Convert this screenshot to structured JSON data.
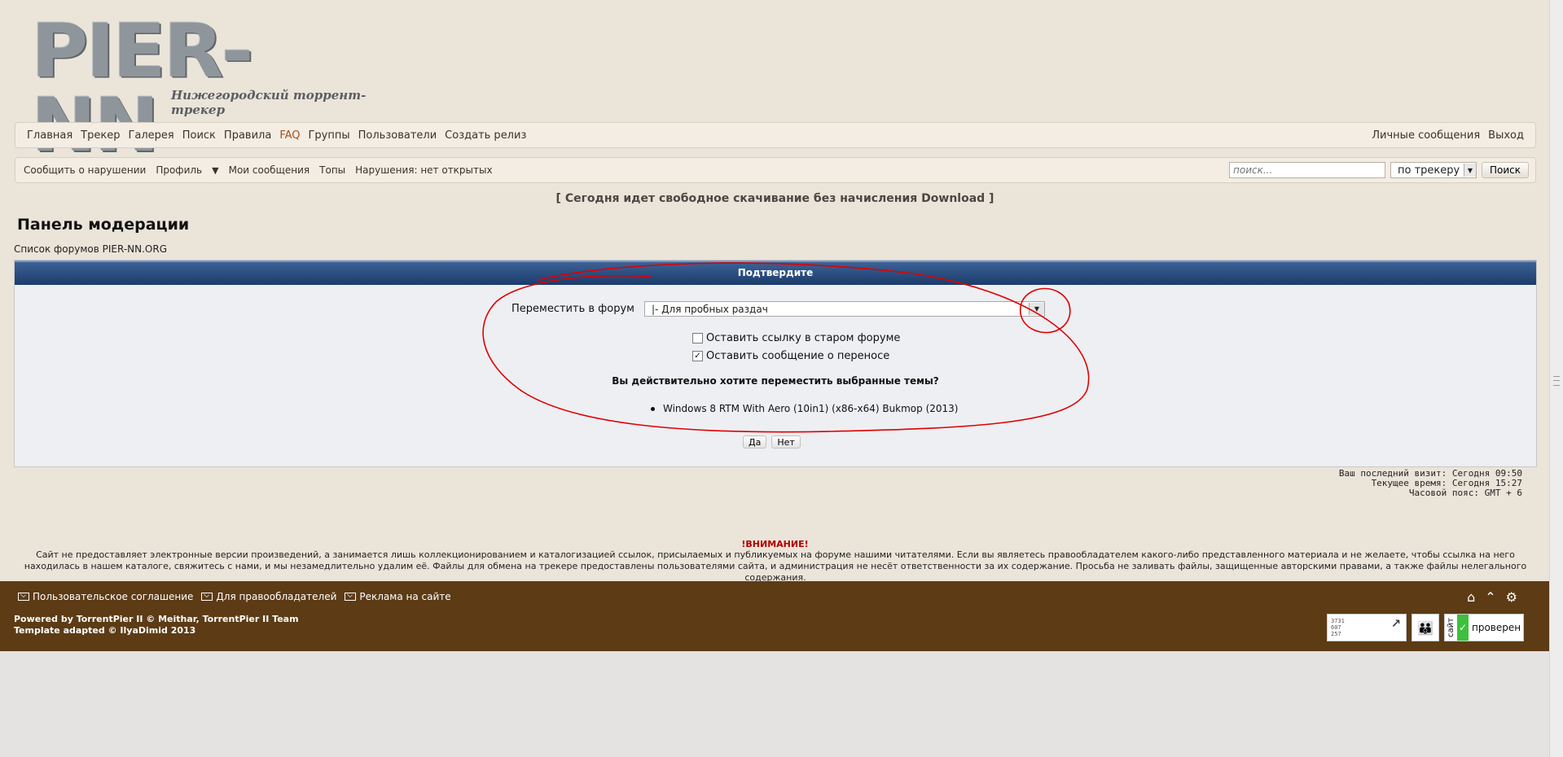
{
  "logo": {
    "title": "PIER-NN",
    "subtitle": "Нижегородский торрент-трекер"
  },
  "nav": {
    "items": [
      "Главная",
      "Трекер",
      "Галерея",
      "Поиск",
      "Правила",
      "FAQ",
      "Группы",
      "Пользователи",
      "Создать релиз"
    ],
    "right": [
      "Личные сообщения",
      "Выход"
    ]
  },
  "subnav": {
    "items": [
      "Сообщить о нарушении",
      "Профиль",
      "Мои сообщения",
      "Топы",
      "Нарушения: нет открытых"
    ],
    "search_placeholder": "поиск...",
    "search_scope": "по трекеру",
    "search_button": "Поиск"
  },
  "announcement": "[ Сегодня идет свободное скачивание без начисления Download ]",
  "page_title": "Панель модерации",
  "breadcrumb": "Список форумов PIER-NN.ORG",
  "panel": {
    "header": "Подтвердите",
    "move_label": "Переместить в форум",
    "forum_value": "|- Для пробных раздач",
    "leave_link": "Оставить ссылку в старом форуме",
    "leave_link_checked": false,
    "leave_message": "Оставить сообщение о переносе",
    "leave_message_checked": true,
    "question": "Вы действительно хотите переместить выбранные темы?",
    "topic": "Windows 8 RTM With Aero (10in1) (x86-x64) Bukmop (2013)",
    "yes": "Да",
    "no": "Нет"
  },
  "visit": {
    "last": "Ваш последний визит: Сегодня 09:50",
    "current": "Текущее время: Сегодня 15:27",
    "timezone": "Часовой пояс: GMT + 6"
  },
  "warning": {
    "title": "!ВНИМАНИЕ!",
    "text": "Сайт не предоставляет электронные версии произведений, а занимается лишь коллекционированием и каталогизацией ссылок, присылаемых и публикуемых на форуме нашими читателями. Если вы являетесь правообладателем какого-либо представленного материала и не желаете, чтобы ссылка на него находилась в нашем каталоге, свяжитесь с нами, и мы незамедлительно удалим её. Файлы для обмена на трекере предоставлены пользователями сайта, и администрация не несёт ответственности за их содержание. Просьба не заливать файлы, защищенные авторскими правами, а также файлы нелегального содержания."
  },
  "footer": {
    "links": [
      "Пользовательское соглашение",
      "Для правообладателей",
      "Реклама на сайте"
    ],
    "powered": "Powered by TorrentPier II © Meithar, TorrentPier II Team",
    "template": "Template adapted © IlyaDimid 2013",
    "counter_lines": [
      "3731",
      "607",
      "257"
    ],
    "check_vertical": "сайт",
    "check_text": "проверен"
  },
  "colors": {
    "header_blue": "#1b3c6b",
    "footer_brown": "#5c3b15",
    "annotation_red": "#e00000",
    "warning_red": "#b00000"
  }
}
